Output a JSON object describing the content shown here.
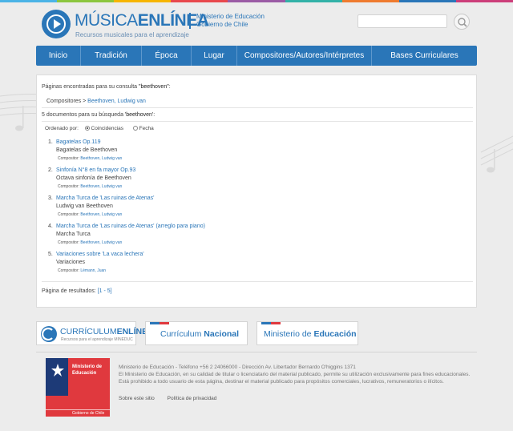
{
  "site": {
    "brand_light": "MÚSICA",
    "brand_bold": "ENLÍNEA",
    "tagline": "Recursos musicales para el aprendizaje",
    "ministry_line1": "Ministerio de Educación",
    "ministry_line2": "Gobierno de Chile"
  },
  "search": {
    "value": "",
    "placeholder": ""
  },
  "nav": {
    "items": [
      {
        "label": "Inicio"
      },
      {
        "label": "Tradición"
      },
      {
        "label": "Época"
      },
      {
        "label": "Lugar"
      },
      {
        "label": "Compositores/Autores/Intérpretes"
      },
      {
        "label": "Bases Curriculares"
      }
    ]
  },
  "results_panel": {
    "found_prefix": "Páginas encontradas para su consulta ",
    "found_query": "\"beethoven\"",
    "found_suffix": ":",
    "breadcrumb_root": "Compositores >",
    "breadcrumb_link": "Beethoven, Ludwig van",
    "docs_prefix": "5 documentos para su búsqueda ",
    "docs_query": "'beethoven'",
    "docs_suffix": ":",
    "sort_label": "Ordenado por:",
    "sort_options": [
      {
        "label": "Coincidencias",
        "selected": true
      },
      {
        "label": "Fecha",
        "selected": false
      }
    ],
    "results": [
      {
        "num": "1.",
        "title": "Bagatelas Op.119",
        "subtitle": "Bagatelas de Beethoven",
        "composer_label": "Compositor:",
        "composer": "Beethoven, Ludwig van"
      },
      {
        "num": "2.",
        "title": "Sinfonía N°8 en fa mayor Op.93",
        "subtitle": "Octava sinfonía de Beethoven",
        "composer_label": "Compositor:",
        "composer": "Beethoven, Ludwig van"
      },
      {
        "num": "3.",
        "title": "Marcha Turca de 'Las ruinas de Atenas'",
        "subtitle": "Ludwig van Beethoven",
        "composer_label": "Compositor:",
        "composer": "Beethoven, Ludwig van"
      },
      {
        "num": "4.",
        "title": "Marcha Turca de 'Las ruinas de Atenas' (arreglo para piano)",
        "subtitle": "Marcha Turca",
        "composer_label": "Compositor:",
        "composer": "Beethoven, Ludwig van"
      },
      {
        "num": "5.",
        "title": "Variaciones sobre 'La vaca lechera'",
        "subtitle": "Variaciones",
        "composer_label": "Compositor:",
        "composer": "Lémann, Juan"
      }
    ],
    "pagination_label": "Página de resultados:",
    "pagination_link": "[1 - 5]"
  },
  "footer": {
    "curriculum_brand_light": "CURRÍCULUM",
    "curriculum_brand_bold": "ENLÍNEA",
    "curriculum_tagline": "Recursos para el aprendizaje MINEDUC",
    "curriculum_nacional_light": "Currículum ",
    "curriculum_nacional_bold": "Nacional",
    "ministerio_light": "Ministerio de ",
    "ministerio_bold": "Educación",
    "gob_line1": "Ministerio de",
    "gob_line2": "Educación",
    "gob_bottom": "Gobierno de Chile",
    "contact": "Ministerio de Educación - Teléfono +56 2 24066000 - Dirección Av. Libertador Bernardo O'higgins 1371",
    "legal": "El Ministerio de Educación, en su calidad de titular o licenciatario del material publicado, permite su utilización exclusivamente para fines educacionales. Está prohibido a todo usuario de esta página, destinar el material publicado para propósitos comerciales, lucrativos, remuneratorios o ilícitos.",
    "links": [
      {
        "label": "Sobre este sitio"
      },
      {
        "label": "Política de privacidad"
      }
    ]
  },
  "colors": {
    "accent": "#2a76b8",
    "nav": "#2a76b8",
    "gob_red": "#e0393e",
    "gob_blue": "#1d3a77",
    "stripe": [
      "#4bb3e6",
      "#8cc63f",
      "#f7b500",
      "#e8484d",
      "#9b5ba5",
      "#33b2a8",
      "#ef7b2f",
      "#2a76b8",
      "#cc3e7a"
    ]
  }
}
